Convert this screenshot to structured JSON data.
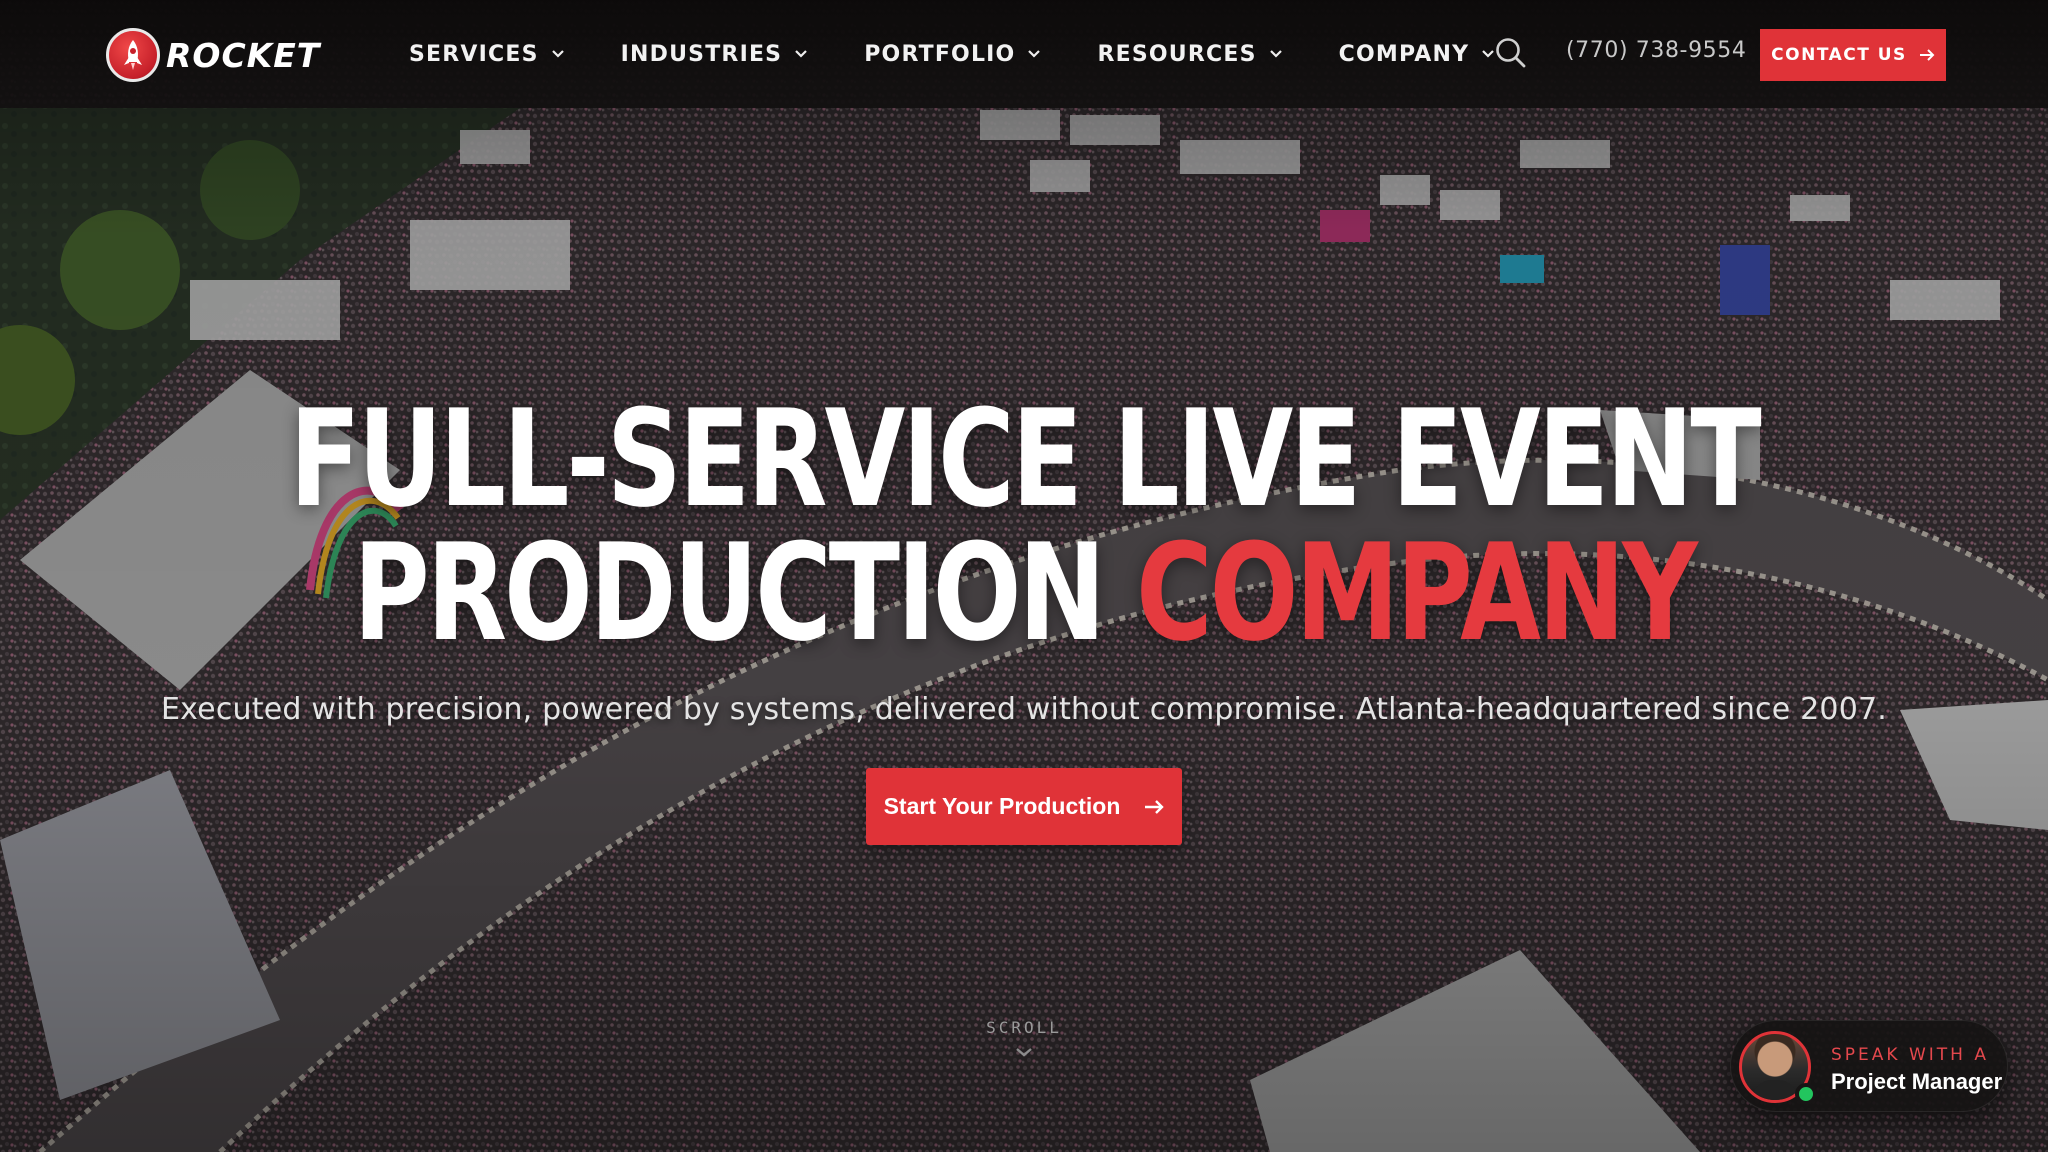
{
  "brand": {
    "name": "ROCKET",
    "logo_icon": "rocket-icon",
    "accent": "#e03338"
  },
  "nav": {
    "items": [
      {
        "label": "SERVICES"
      },
      {
        "label": "INDUSTRIES"
      },
      {
        "label": "PORTFOLIO"
      },
      {
        "label": "RESOURCES"
      },
      {
        "label": "COMPANY"
      }
    ],
    "dropdown_icon": "chevron-down-icon"
  },
  "header": {
    "search_icon": "search-icon",
    "phone": "(770) 738-9554",
    "contact_label": "CONTACT US"
  },
  "hero": {
    "headline_line1": "FULL-SERVICE LIVE EVENT",
    "headline_line2_a": "PRODUCTION",
    "headline_line2_b": "COMPANY",
    "subhead": "Executed with precision, powered by systems, delivered without compromise. Atlanta-headquartered since 2007.",
    "cta_label": "Start Your Production",
    "scroll_label": "SCROLL"
  },
  "pm_widget": {
    "kicker": "SPEAK WITH A",
    "title": "Project Manager",
    "status_color": "#22c55e"
  }
}
